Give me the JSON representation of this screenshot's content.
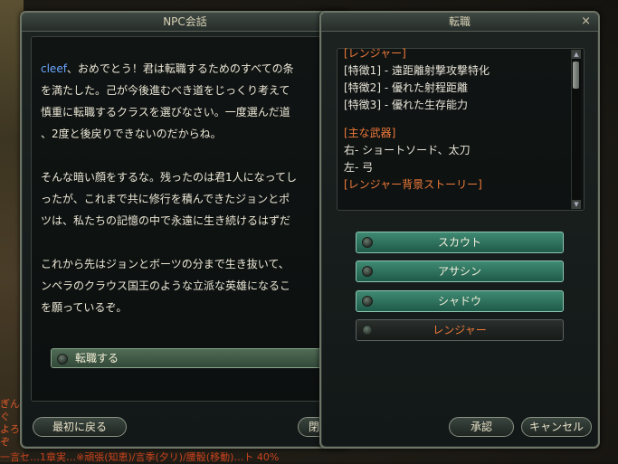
{
  "npc_window": {
    "title": "NPC会話",
    "npc_name": "cleef",
    "paragraph1": [
      "、おめでとう！君は転職するためのすべての条",
      "を満たした。己が今後進むべき道をじっくり考えて",
      "慎重に転職するクラスを選びなさい。一度選んだ道",
      "、2度と後戻りできないのだからね。"
    ],
    "paragraph2": [
      "そんな暗い顔をするな。残ったのは君1人になってし",
      "ったが、これまで共に修行を積んできたジョンとポ",
      "ツは、私たちの記憶の中で永遠に生き続けるはずだ"
    ],
    "paragraph3": [
      "これから先はジョンとボーツの分まで生き抜いて、",
      "ンペラのクラウス国王のような立派な英雄になるこ",
      "を願っているぞ。"
    ],
    "option_label": "転職する",
    "back_button": "最初に戻る",
    "close_button": "閉じる"
  },
  "job_window": {
    "title": "転職",
    "close_icon": "×",
    "info": {
      "class_header": "[レンジャー]",
      "traits": [
        "[特徴1] - 遠距離射撃攻撃特化",
        "[特徴2] - 優れた射程距離",
        "[特徴3] - 優れた生存能力"
      ],
      "weapons_header": "[主な武器]",
      "weapons": [
        "右- ショートソード、太刀",
        "左- 弓"
      ],
      "story_header": "[レンジャー背景ストーリー]"
    },
    "classes": [
      "スカウト",
      "アサシン",
      "シャドウ",
      "レンジャー"
    ],
    "selected_class": "レンジャー",
    "confirm_button": "承認",
    "cancel_button": "キャンセル"
  },
  "background": {
    "chat_lines": [
      "ぎんぐ",
      "よろ",
      "ぞ"
    ],
    "bottom_text": "一言セ…1章実…※頑張(知恵)/言季(夕リ)/腰骰(移動)…ト 40%"
  },
  "colors": {
    "accent_orange": "#f07a3a",
    "name_blue": "#6aa7ff",
    "button_green": "#2f7a63"
  }
}
